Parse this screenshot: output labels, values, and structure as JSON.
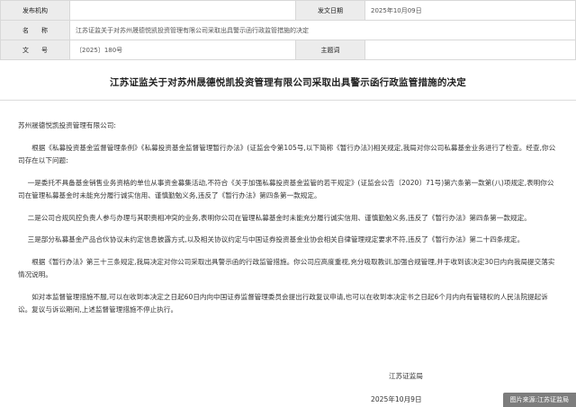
{
  "meta": {
    "row1": {
      "label": "发布机构",
      "value": "",
      "label2": "发文日期",
      "value2": "2025年10月09日"
    },
    "row2": {
      "label": "名　　称",
      "value": "江苏证监关于对苏州晟德悦凯投资管理有限公司采取出具警示函行政监管措施的决定"
    },
    "row3": {
      "label": "文　　号",
      "value": "〔2025〕180号",
      "label2": "主题词",
      "value2": ""
    }
  },
  "document": {
    "title": "江苏证监关于对苏州晟德悦凯投资管理有限公司采取出具警示函行政监管措施的决定",
    "addressee": "苏州晟德悦凯投资管理有限公司:",
    "paragraphs": [
      "根据《私募投资基金监督管理条例》《私募投资基金监督管理暂行办法》(证监会令第105号,以下简称《暂行办法》)相关规定,我局对你公司私募基金业务进行了检查。经查,你公司存在以下问题:",
      "一是委托不具备基金销售业务资格的单位从事资金募集活动,不符合《关于加强私募投资基金监管的若干规定》(证监会公告〔2020〕71号)第六条第一款第(八)项规定,表明你公司在管理私募基金时未能充分履行诚实信用、谨慎勤勉义务,违反了《暂行办法》第四条第一款规定。",
      "二是公司合规风控负责人参与办理与其职责相冲突的业务,表明你公司在管理私募基金时未能充分履行诚实信用、谨慎勤勉义务,违反了《暂行办法》第四条第一款规定。",
      "三是部分私募基金产品合伙协议未约定信息披露方式,以及相关协议约定与中国证券投资基金业协会相关自律管理规定要求不符,违反了《暂行办法》第二十四条规定。",
      "根据《暂行办法》第三十三条规定,我局决定对你公司采取出具警示函的行政监管措施。你公司应高度重视,充分吸取教训,加强合规管理,并于收到该决定30日内向我局提交落实情况说明。",
      "如对本监督管理措施不服,可以在收到本决定之日起60日内向中国证券监督管理委员会提出行政复议申请,也可以在收到本决定书之日起6个月内向有管辖权的人民法院提起诉讼。复议与诉讼期间,上述监督管理措施不停止执行。"
    ],
    "signature": "江苏证监局",
    "date": "2025年10月9日"
  },
  "source": "图片来源:江苏证监局"
}
